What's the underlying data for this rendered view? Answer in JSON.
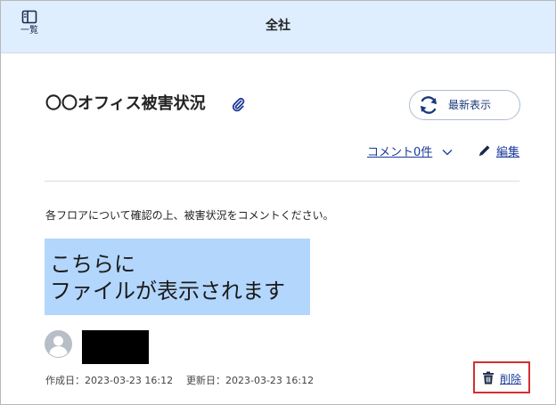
{
  "header": {
    "title": "全社",
    "list_button_label": "一覧",
    "list_icon": "list-panel-icon"
  },
  "post": {
    "title": "〇〇オフィス被害状況",
    "attachment_icon": "paperclip-icon",
    "refresh_label": "最新表示",
    "refresh_icon": "refresh-icon",
    "comment_link": "コメント0件",
    "edit_label": "編集",
    "edit_icon": "pencil-icon",
    "description": "各フロアについて確認の上、被害状況をコメントください。",
    "file_placeholder": {
      "line1": "こちらに",
      "line2": "ファイルが表示されます"
    },
    "created": "作成日：2023-03-23 16:12",
    "updated": "更新日：2023-03-23 16:12",
    "delete_label": "削除",
    "delete_icon": "trash-icon"
  },
  "colors": {
    "header_bg": "#dfeefe",
    "link": "#1b3a9a",
    "file_box_bg": "#b3d6fc",
    "highlight_border": "#d32f2f"
  }
}
